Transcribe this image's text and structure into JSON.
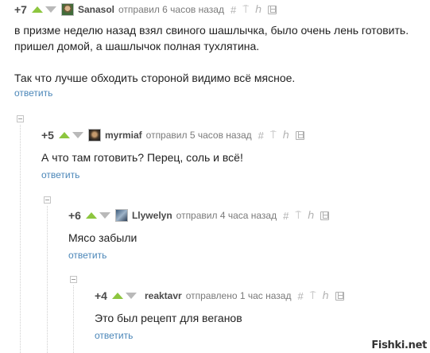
{
  "comments": [
    {
      "rating": "+7",
      "username": "Sanasol",
      "meta": "отправил 6 часов назад",
      "text_lines": [
        "в призме неделю назад взял свиного шашлычка, было очень лень готовить.",
        "пришел домой, а шашлычок полная тухлятина.",
        "",
        "Так что лучше обходить стороной видимо всё мясное."
      ],
      "reply": "ответить"
    },
    {
      "rating": "+5",
      "username": "myrmiaf",
      "meta": "отправил 5 часов назад",
      "text_lines": [
        "А что там готовить? Перец, соль и всё!"
      ],
      "reply": "ответить"
    },
    {
      "rating": "+6",
      "username": "Llywelyn",
      "meta": "отправил 4 часа назад",
      "text_lines": [
        "Мясо забыли"
      ],
      "reply": "ответить"
    },
    {
      "rating": "+4",
      "username": "reaktavr",
      "meta": "отправлено 1 час назад",
      "text_lines": [
        "Это был рецепт для веганов"
      ],
      "reply": "ответить"
    }
  ],
  "tools": {
    "hash": "#",
    "pin": "⍑",
    "branch": "⫯"
  },
  "watermark": "Fishki.net",
  "colors": {
    "vote_up": "#8dc63f",
    "vote_down": "#b9b9b9",
    "link": "#4a86b8"
  }
}
